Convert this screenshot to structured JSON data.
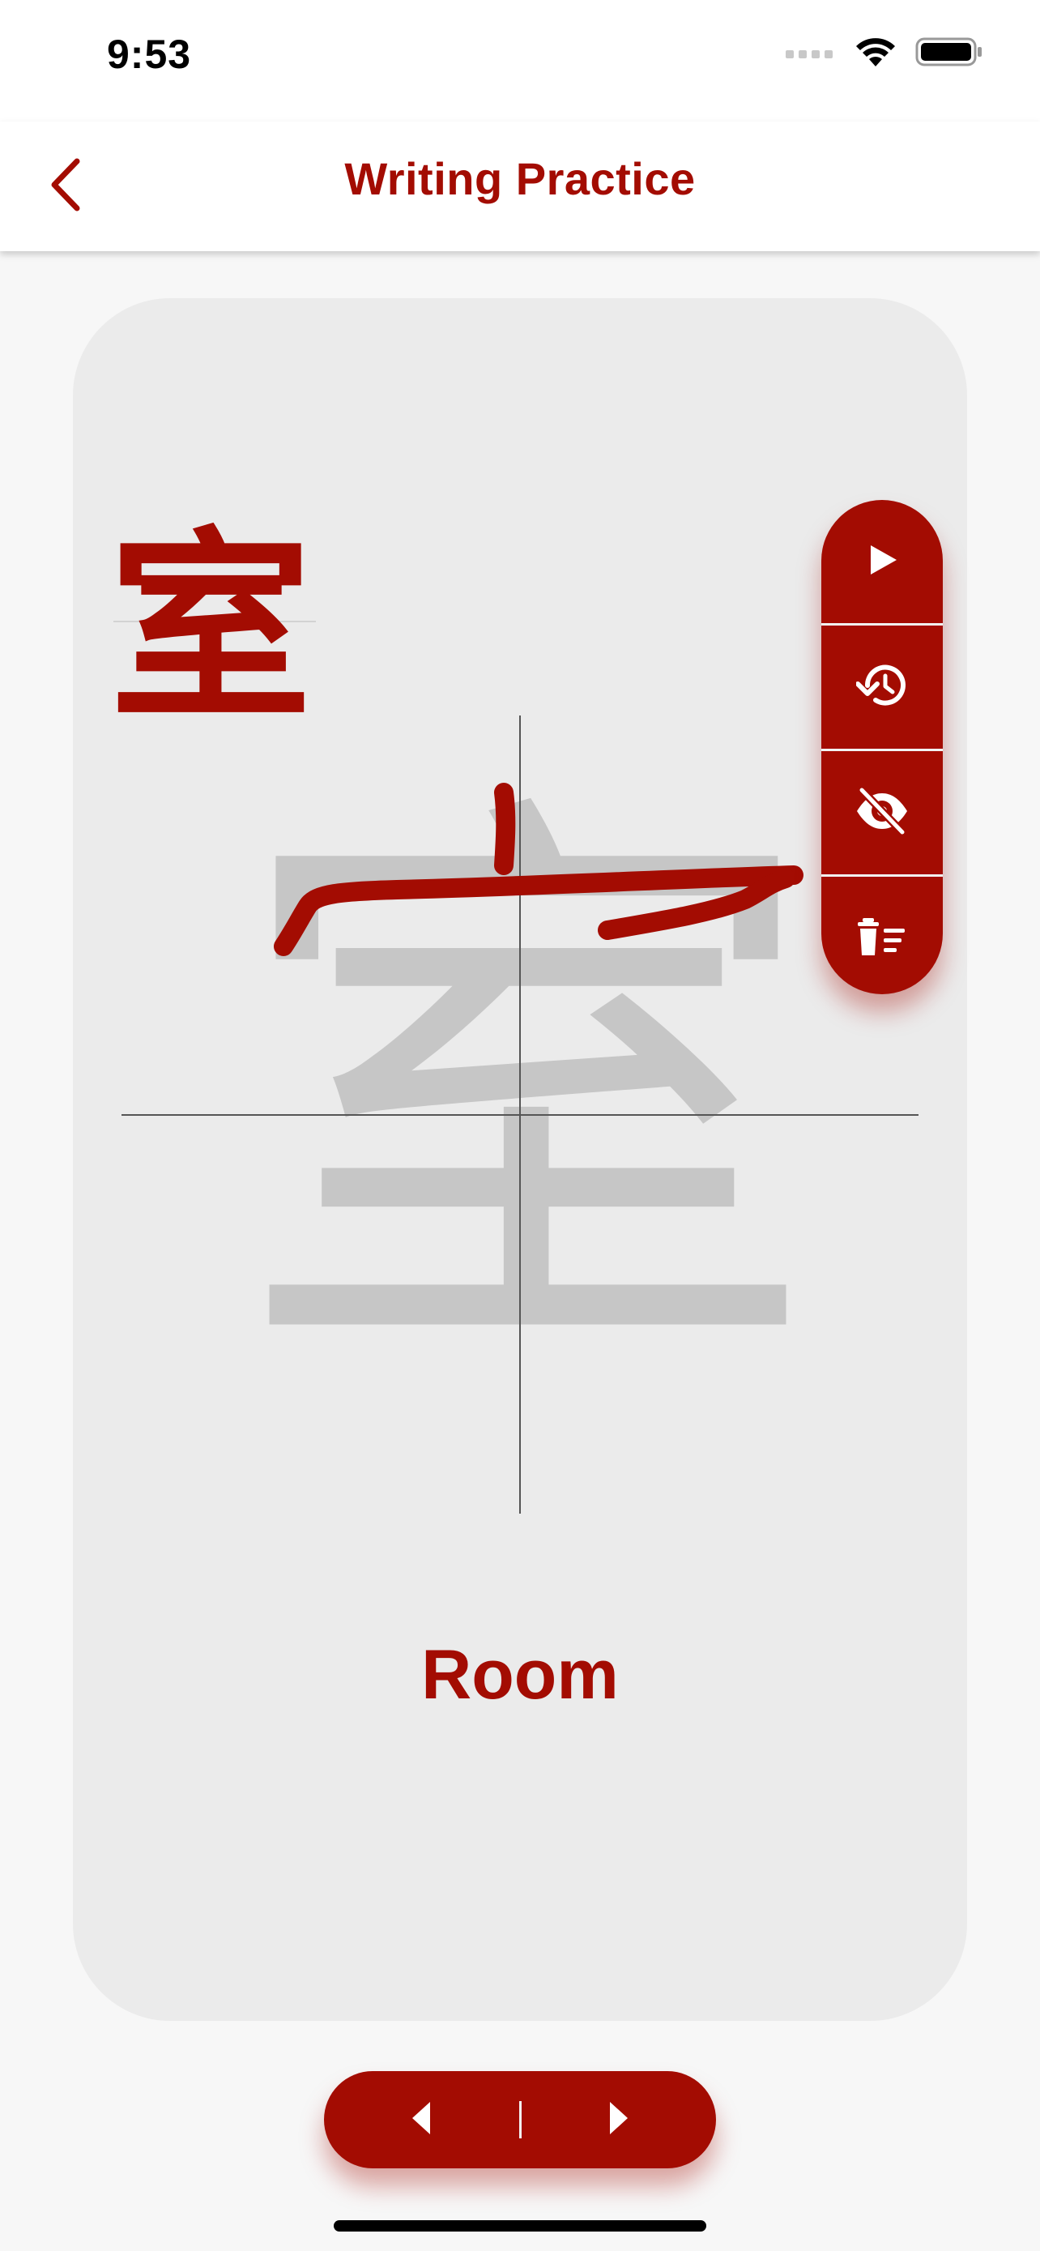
{
  "status_bar": {
    "time": "9:53",
    "icons": [
      "signal-icon",
      "wifi-icon",
      "battery-icon"
    ]
  },
  "header": {
    "title": "Writing Practice",
    "back_icon": "chevron-left-icon"
  },
  "practice": {
    "character": "室",
    "meaning": "Room",
    "tools": [
      {
        "name": "play-icon",
        "action": "play"
      },
      {
        "name": "history-icon",
        "action": "replay"
      },
      {
        "name": "eye-off-icon",
        "action": "hide-guide"
      },
      {
        "name": "clear-icon",
        "action": "clear"
      }
    ]
  },
  "pager": {
    "prev_icon": "prev-triangle-icon",
    "next_icon": "next-triangle-icon"
  },
  "colors": {
    "accent": "#a30c02",
    "card": "#ebebeb",
    "guide": "#c6c6c6",
    "background": "#f7f7f7"
  }
}
